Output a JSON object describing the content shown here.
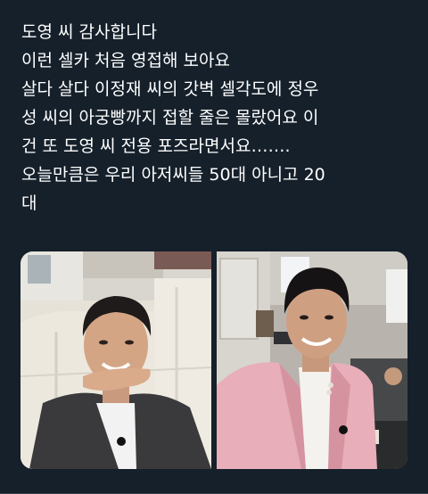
{
  "tweet": {
    "text_lines": [
      "도영 씨 감사합니다",
      "이런 셀카 처음 영접해 보아요",
      "살다 살다 이정재 씨의 갓벽 셀각도에 정우",
      "성 씨의 아궁빵까지 접할 줄은 몰랐어요 이",
      "건 또 도영 씨 전용 포즈라면서요…….",
      "오늘만큼은 우리 아저씨들 50대 아니고 20",
      "대"
    ]
  },
  "media": {
    "photos": [
      {
        "name": "selfie-photo-left"
      },
      {
        "name": "selfie-photo-right"
      }
    ]
  },
  "colors": {
    "background": "#15202b",
    "text": "#ffffff",
    "divider": "#38444d"
  }
}
